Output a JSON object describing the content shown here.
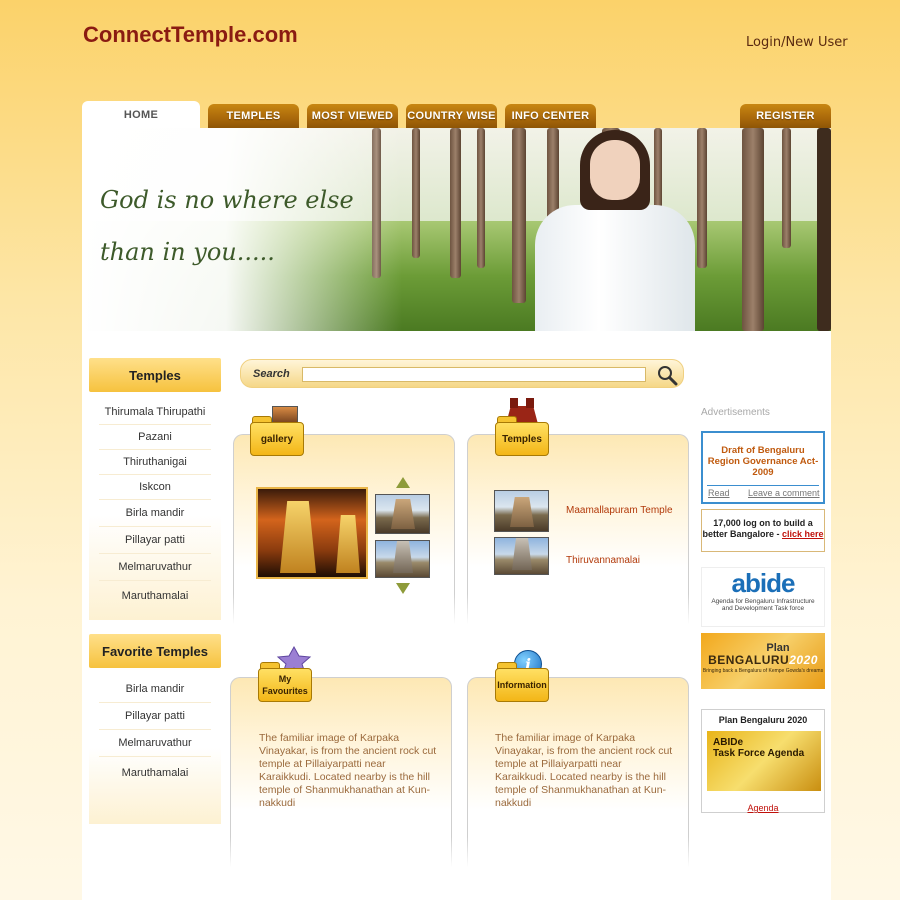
{
  "site": {
    "logo": "ConnectTemple.com",
    "login": "Login/New User"
  },
  "nav": {
    "tabs": [
      "HOME",
      "TEMPLES",
      "MOST VIEWED",
      "COUNTRY WISE",
      "INFO CENTER"
    ],
    "register": "REGISTER"
  },
  "banner": {
    "quote_line1": "God is no where else",
    "quote_line2": "than in you....."
  },
  "sidebar": {
    "temples_title": "Temples",
    "temples": [
      "Thirumala Thirupathi",
      "Pazani",
      "Thiruthanigai",
      "Iskcon",
      "Birla mandir",
      "Pillayar patti",
      "Melmaruvathur",
      "Maruthamalai"
    ],
    "favorites_title": "Favorite Temples",
    "favorites": [
      "Birla mandir",
      "Pillayar patti",
      "Melmaruvathur",
      "Maruthamalai"
    ]
  },
  "search": {
    "label": "Search",
    "value": ""
  },
  "cards": {
    "gallery_label": "gallery",
    "temples_label": "Temples",
    "temple_links": [
      "Maamallapuram Temple",
      "Thiruvannamalai"
    ],
    "favourites_label_line1": "My",
    "favourites_label_line2": "Favourites",
    "information_label": "Information",
    "favourites_text": "The familiar image of Karpaka Vinayakar, is from the ancient rock cut temple at Pillaiyarpatti near Karaikkudi. Located nearby is the hill temple of Shanmukhanathan at Kun-nakkudi",
    "information_text": "The familiar image of Karpaka Vinayakar, is from the ancient rock cut temple at Pillaiyarpatti near Karaikkudi. Located nearby is the hill temple of Shanmukhanathan at Kun-nakkudi"
  },
  "ads": {
    "title": "Advertisements",
    "ad1_title": "Draft of Bengaluru Region Governance Act-2009",
    "ad1_read": "Read",
    "ad1_comment": "Leave a comment",
    "ad2_text": "17,000 log on to build a better Bangalore - ",
    "ad2_link": "click here",
    "abide_logo": "abide",
    "abide_text": "Agenda for Bengaluru Infrastructure and Development Task force",
    "plan_top": "Plan",
    "plan_main": "BENGALURU",
    "plan_year": "2020",
    "plan_tagline": "Bringing back a Bengaluru of Kempe Gowda's dreams",
    "plan_box_title": "Plan Bengaluru 2020",
    "plan_box_heading1": "ABIDe",
    "plan_box_heading2": "Task Force Agenda",
    "plan_box_link": "Agenda"
  },
  "colors": {
    "brand": "#8a1b12",
    "tab": "#b06f0c",
    "sidebar_head": "#f6c23e",
    "link": "#b2390a",
    "ad_blue": "#3b8ecf"
  }
}
